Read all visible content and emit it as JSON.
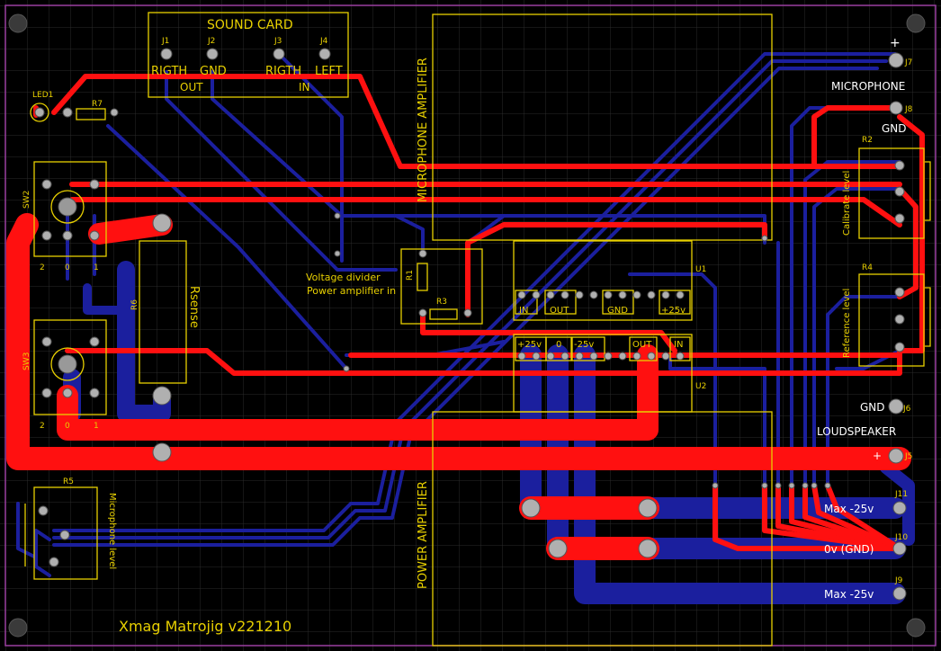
{
  "colors": {
    "background": "#000000",
    "grid": "#2a2a2a",
    "board_edge": "#9a3fa0",
    "top_copper": "#ff1010",
    "bottom_copper": "#1b1f9e",
    "silkscreen": "#e8d000",
    "pad": "#b0b0b0",
    "label_white": "#ffffff"
  },
  "title": "Xmag Matrojig v221210",
  "blocks": {
    "sound_card": "SOUND CARD",
    "microphone_amplifier": "MICROPHONE AMPLIFIER",
    "power_amplifier": "POWER AMPLIFIER",
    "voltage_divider": [
      "Voltage divider",
      "Power amplifier in"
    ],
    "rsense": "Rsense"
  },
  "sound_card": {
    "j1": "J1",
    "j2": "J2",
    "j3": "J3",
    "j4": "J4",
    "rigth_out": "RIGTH",
    "gnd": "GND",
    "rigth_in": "RIGTH",
    "left": "LEFT",
    "out": "OUT",
    "in": "IN"
  },
  "refdes": {
    "led1": "LED1",
    "r7": "R7",
    "sw2": "SW2",
    "sw3": "SW3",
    "r6": "R6",
    "r1": "R1",
    "r3": "R3",
    "u1": "U1",
    "u2": "U2",
    "r2": "R2",
    "r4": "R4",
    "r5": "R5",
    "j5": "J5",
    "j6": "J6",
    "j7": "J7",
    "j8": "J8",
    "j9": "J9",
    "j10": "J10",
    "j11": "J11"
  },
  "switch_positions": {
    "sw2": [
      "2",
      "0",
      "1"
    ],
    "sw3": [
      "2",
      "0",
      "1"
    ]
  },
  "u1_labels": [
    "IN",
    "OUT",
    "GND",
    "+25v"
  ],
  "u2_labels": [
    "+25v",
    "0",
    "-25v",
    "OUT",
    "IN"
  ],
  "right_labels": {
    "plus_top": "+",
    "microphone": "MICROPHONE",
    "gnd_mic": "GND",
    "calibrate": "Calibrate level",
    "reference": "Reference level",
    "gnd_speaker": "GND",
    "loudspeaker": "LOUDSPEAKER",
    "plus_speaker": "+",
    "max_neg_top": "Max -25v",
    "zero_gnd": "0v (GND)",
    "max_neg_bottom": "Max -25v"
  },
  "microphone_level": "Microphone level"
}
